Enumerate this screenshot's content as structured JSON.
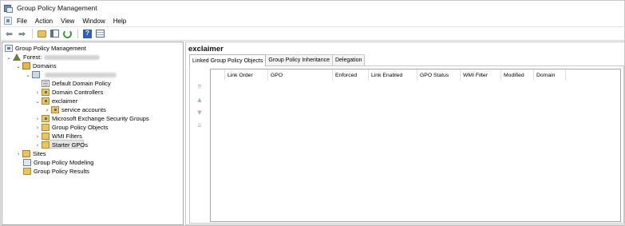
{
  "window": {
    "title": "Group Policy Management"
  },
  "menu": {
    "items": [
      "File",
      "Action",
      "View",
      "Window",
      "Help"
    ]
  },
  "toolbar": {
    "buttons": [
      "back-icon",
      "forward-icon",
      "up-folder-icon",
      "show-hide-tree-icon",
      "refresh-icon",
      "help-icon",
      "properties-icon"
    ]
  },
  "tree": {
    "root": "Group Policy Management",
    "forest_label": "Forest:",
    "domains": "Domains",
    "default_domain_policy": "Default Domain Policy",
    "domain_controllers": "Domain Controllers",
    "exclaimer": "exclaimer",
    "service_accounts": "service accounts",
    "ms_exchange": "Microsoft Exchange Security Groups",
    "gpo": "Group Policy Objects",
    "wmi": "WMI Filters",
    "starter": "Starter GPOs",
    "sites": "Sites",
    "modeling": "Group Policy Modeling",
    "results": "Group Policy Results"
  },
  "detail": {
    "title": "exclaimer",
    "tabs": [
      "Linked Group Policy Objects",
      "Group Policy Inheritance",
      "Delegation"
    ],
    "columns": [
      "Link Order",
      "GPO",
      "Enforced",
      "Link Enabled",
      "GPO Status",
      "WMI Filter",
      "Modified",
      "Domain"
    ]
  },
  "colors": {
    "border": "#a9a9a9",
    "selection": "#e5e5e5"
  }
}
